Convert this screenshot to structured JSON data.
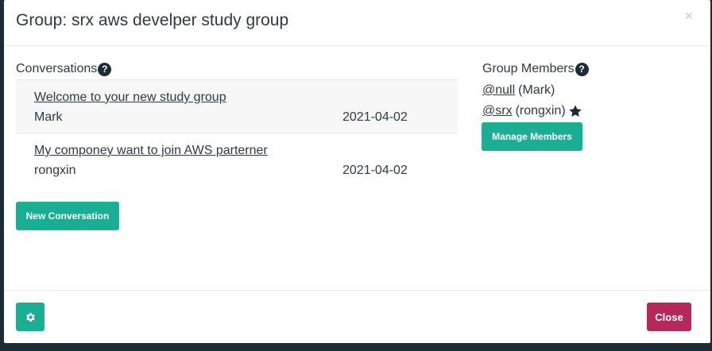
{
  "modal": {
    "title": "Group: srx aws develper study group",
    "close_glyph": "×"
  },
  "conversations": {
    "heading": "Conversations",
    "help_glyph": "?",
    "items": [
      {
        "title": "Welcome to your new study group",
        "author": "Mark",
        "date": "2021-04-02"
      },
      {
        "title": "My componey want to join AWS parterner",
        "author": "rongxin",
        "date": "2021-04-02"
      }
    ],
    "new_button_label": "New Conversation"
  },
  "members": {
    "heading": "Group Members",
    "help_glyph": "?",
    "items": [
      {
        "handle": "@null",
        "name": "(Mark)",
        "is_owner": false
      },
      {
        "handle": "@srx",
        "name": "(rongxin)",
        "is_owner": true
      }
    ],
    "manage_button_label": "Manage Members"
  },
  "footer": {
    "close_label": "Close",
    "settings_icon": "gear-icon"
  },
  "colors": {
    "primary": "#1aae93",
    "danger": "#b5285a",
    "text": "#2b3a47"
  }
}
